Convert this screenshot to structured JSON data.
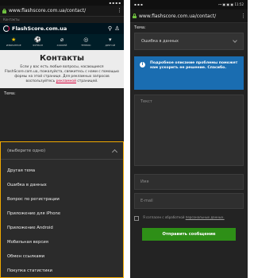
{
  "left": {
    "status_text": "▪ ▪ ▪ ▪",
    "browser": {
      "url": "www.flashscore.com.ua/contact/"
    },
    "breadcrumb": "Контакты",
    "site": {
      "logo_text": "FlashScore.com.ua",
      "sports": [
        {
          "label": "ИЗБРАННОЕ",
          "icon": "★"
        },
        {
          "label": "ФУТБОЛ",
          "icon": "⚽"
        },
        {
          "label": "ХОККЕЙ",
          "icon": "⌀"
        },
        {
          "label": "ТЕННИС",
          "icon": "◎"
        },
        {
          "label": "ДРУГОЙ",
          "icon": "▾"
        }
      ]
    },
    "contacts": {
      "title": "Контакты",
      "text": "Если у вас есть любые вопросы, насающиеся FlashScore.com.ua, пожалуйста, свяжитесь с нами с помощью формы на этой странице. Для рекламных запросов воспользуйтесь",
      "link": "рекламной",
      "text_after": "страницей."
    },
    "form": {
      "topic_label": "Тема:"
    },
    "dropdown": {
      "placeholder": "(выберите одно)",
      "options": [
        "Другая тема",
        "Ошибка в данных",
        "Вопрос по регистрации",
        "Приложение для iPhone",
        "Приложение Android",
        "Мобильная версия",
        "Обмен ссылками",
        "Покупка статистики"
      ]
    }
  },
  "right": {
    "status": {
      "left": "▪ ▪ ▪",
      "right": "⊶ ▣ ▣ ▣ 11:52"
    },
    "browser": {
      "url": "www.flashscore.com.ua/contact/"
    },
    "form": {
      "topic_label": "Тема:",
      "topic_value": "Ошибка в данных",
      "info_text": "Подробное описание проблемы поможет нам ускорить ее решение. Спасибо.",
      "text_placeholder": "Текст",
      "name_placeholder": "Имя",
      "email_placeholder": "E-mail",
      "consent_text": "Я согласен с обработкой",
      "consent_link": "персональных данных.",
      "submit_label": "Отправить сообщение"
    }
  },
  "colors": {
    "accent_dropdown_border": "#f0a800",
    "secure_lock": "#6fbf3f",
    "info_box": "#1a6db1",
    "submit_button": "#2e8f17",
    "favorites_active": "#ffc800"
  }
}
